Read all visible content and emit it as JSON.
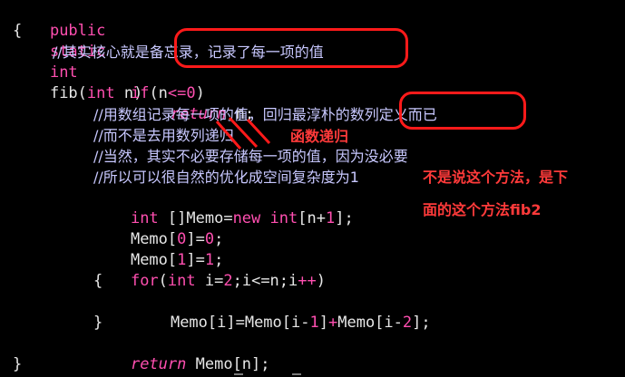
{
  "code": {
    "line1": {
      "kw1": "public",
      "kw2": "static",
      "kw3": "int",
      "fn": "fib",
      "p_open": "(",
      "kw4": "int",
      "arg": " n",
      "p_close": ")"
    },
    "line2": "{",
    "line3": "//其实核心就是备忘录，记录了每一项的值",
    "line4": {
      "kw": "if",
      "open": "(n",
      "op": "<=",
      "num": "0",
      "close": ")"
    },
    "line5": {
      "kw": "return",
      "rest": " n;"
    },
    "line6": "//用数组记录每一项的值，回归最淳朴的数列定义而已",
    "line7": "//而不是去用数列递归",
    "line8": "//当然，其实不必要存储每一项的值，因为没必要",
    "line9": "//所以可以很自然的优化成空间复杂度为1",
    "line10": {
      "kw1": "int",
      "mid": " []Memo=",
      "kw2": "new",
      "kw3": " int",
      "open": "[n+",
      "num": "1",
      "close": "];"
    },
    "line11": {
      "pre": "Memo[",
      "num": "0",
      "post": "]=",
      "val": "0",
      "end": ";"
    },
    "line12": {
      "pre": "Memo[",
      "num": "1",
      "post": "]=",
      "val": "1",
      "end": ";"
    },
    "line13": {
      "kw": "for",
      "open": "(",
      "kw2": "int",
      "a": " i=",
      "n1": "2",
      "b": ";i<=n;i",
      "op": "++",
      "close": ")"
    },
    "line14": "{",
    "line15": {
      "a": "Memo[i]=Memo[i-",
      "n1": "1",
      "b": "]",
      "op": "+",
      "c": "Memo[i-",
      "n2": "2",
      "d": "];"
    },
    "line16": "}",
    "line17": {
      "kw": "return",
      "rest": " Memo[n];"
    },
    "line18": "}"
  },
  "annotations": {
    "recursion": "函数递归",
    "note_line1": "不是说这个方法，是下",
    "note_line2": "面的这个方法fib2"
  },
  "colors": {
    "background": "#000000",
    "comment": "#c8c8ff",
    "keyword": "#ff4fb0",
    "plain": "#e6e6e6",
    "annotation": "#ff3a3a"
  }
}
